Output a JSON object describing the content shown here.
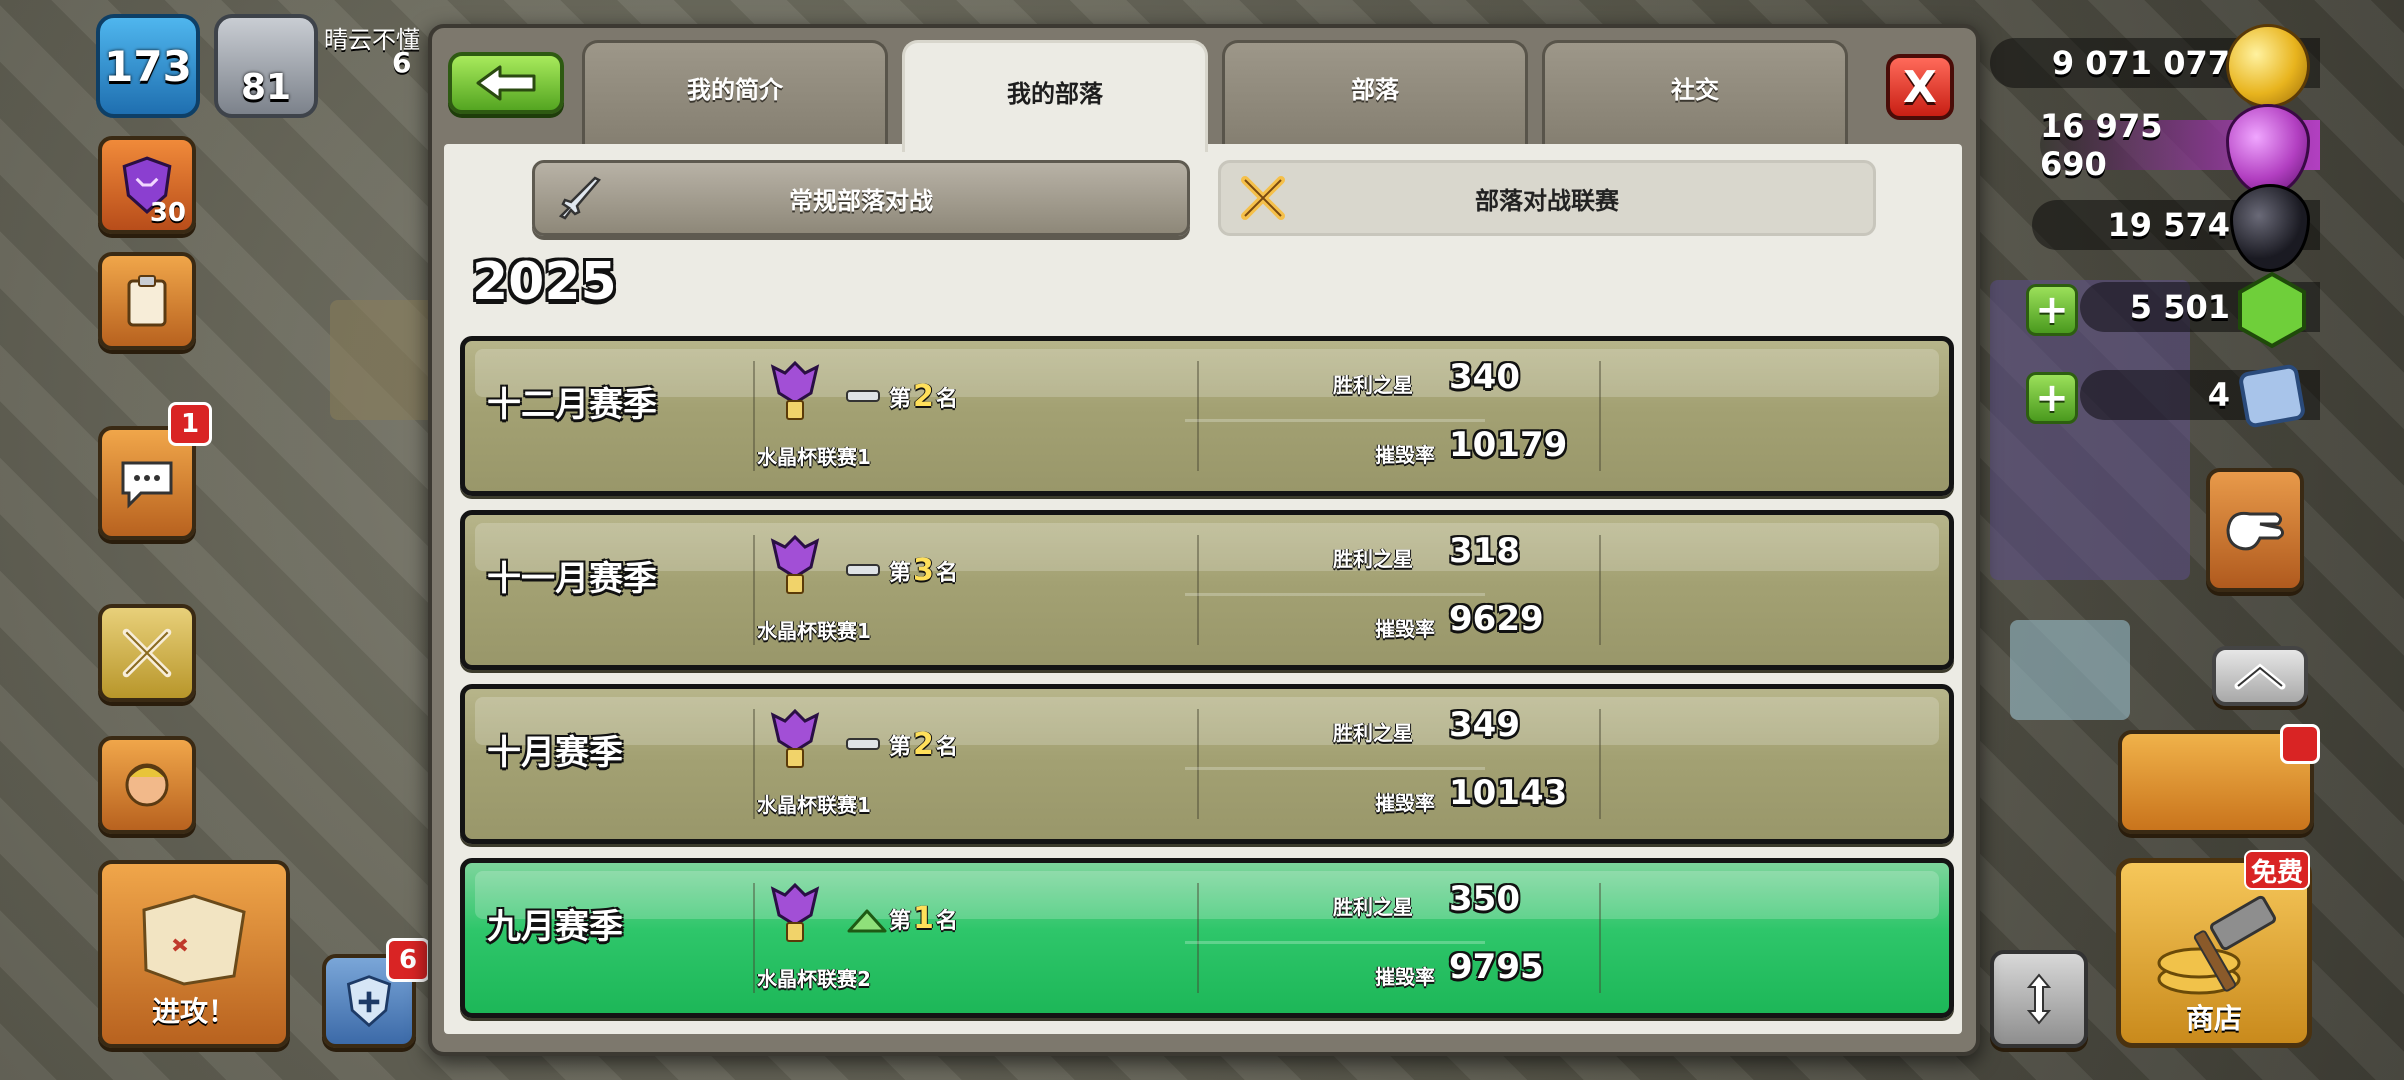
{
  "player": {
    "level": "173",
    "trophies": "81",
    "name": "晴云不懂",
    "sub": "6"
  },
  "hud_left": {
    "league_level": "30",
    "chat_badge": "1",
    "attack_label": "进攻！",
    "shield_badge": "6"
  },
  "resources": {
    "gold": "9 071 077",
    "elixir": "16 975 690",
    "dark_elixir": "19 574",
    "gems": "5 501",
    "tickets": "4"
  },
  "shop": {
    "label": "商店",
    "free_badge": "免费"
  },
  "tabs": [
    "我的简介",
    "我的部落",
    "部落",
    "社交"
  ],
  "active_tab": "我的部落",
  "subtabs": [
    "常规部落对战",
    "部落对战联赛"
  ],
  "year": "2025",
  "labels": {
    "stars": "胜利之星",
    "destruction": "摧毁率"
  },
  "seasons": [
    {
      "name": "十二月赛季",
      "rank_prefix": "第",
      "rank": "2",
      "rank_suffix": "名",
      "league": "水晶杯联赛1",
      "trend": "same",
      "stars": "340",
      "destruction": "10179",
      "highlight": false
    },
    {
      "name": "十一月赛季",
      "rank_prefix": "第",
      "rank": "3",
      "rank_suffix": "名",
      "league": "水晶杯联赛1",
      "trend": "same",
      "stars": "318",
      "destruction": "9629",
      "highlight": false
    },
    {
      "name": "十月赛季",
      "rank_prefix": "第",
      "rank": "2",
      "rank_suffix": "名",
      "league": "水晶杯联赛1",
      "trend": "same",
      "stars": "349",
      "destruction": "10143",
      "highlight": false
    },
    {
      "name": "九月赛季",
      "rank_prefix": "第",
      "rank": "1",
      "rank_suffix": "名",
      "league": "水晶杯联赛2",
      "trend": "up",
      "stars": "350",
      "destruction": "9795",
      "highlight": true
    }
  ],
  "colors": {
    "row_default": "#a3a173",
    "row_highlight": "#2ec66a",
    "accent_green": "#54a521",
    "close_red": "#c81f14"
  }
}
